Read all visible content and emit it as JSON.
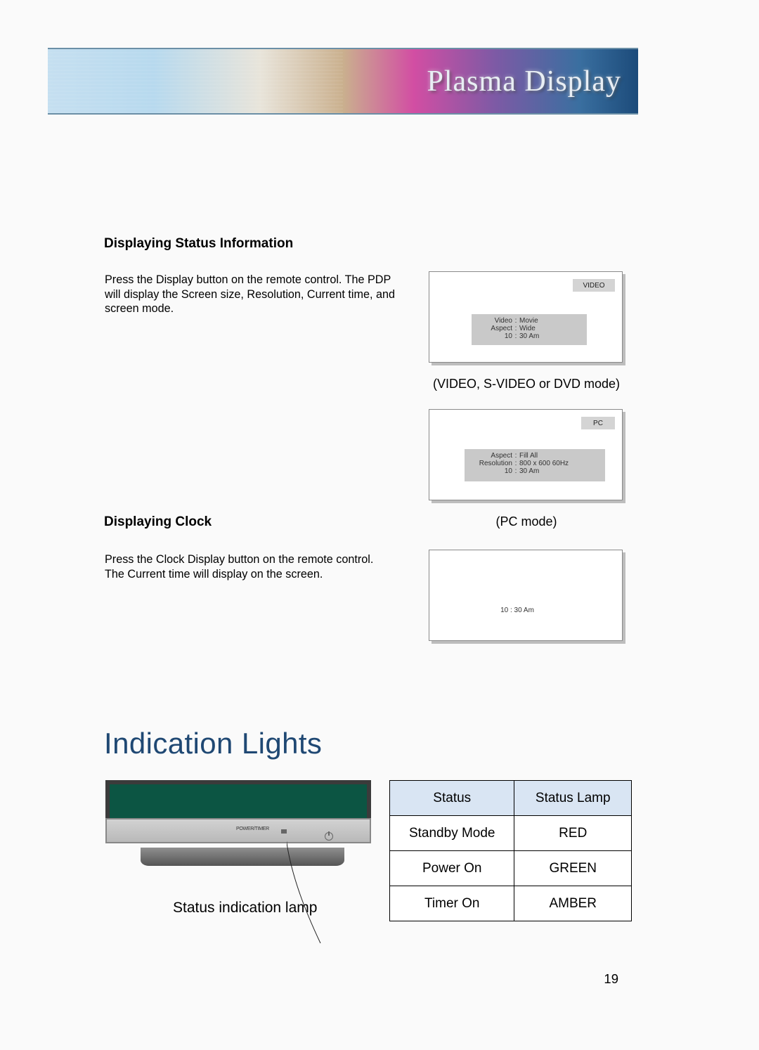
{
  "banner": {
    "title": "Plasma Display"
  },
  "section1": {
    "heading": "Displaying Status Information",
    "body": "Press the Display button on the remote control. The PDP will display the Screen size, Resolution, Current time, and screen mode."
  },
  "screen1": {
    "mode_label": "VIDEO",
    "rows": [
      {
        "label": "Video",
        "value": "Movie"
      },
      {
        "label": "Aspect",
        "value": "Wide"
      },
      {
        "label": "10",
        "value": "30 Am"
      }
    ],
    "caption": "(VIDEO, S-VIDEO or DVD mode)"
  },
  "screen2": {
    "mode_label": "PC",
    "rows": [
      {
        "label": "Aspect",
        "value": "Fill All"
      },
      {
        "label": "Resolution",
        "value": "800 x 600 60Hz"
      },
      {
        "label": "10",
        "value": "30 Am"
      }
    ],
    "caption": "(PC mode)"
  },
  "section2": {
    "heading": "Displaying Clock",
    "body": "Press the Clock Display button on the remote control.\nThe Current time will display on the screen."
  },
  "screen3": {
    "clock": "10 : 30 Am"
  },
  "indication": {
    "title": "Indication Lights",
    "caption": "Status indication lamp",
    "pdp_label": "POWER/TIMER"
  },
  "status_table": {
    "headers": [
      "Status",
      "Status Lamp"
    ],
    "rows": [
      {
        "status": "Standby Mode",
        "lamp": "RED"
      },
      {
        "status": "Power On",
        "lamp": "GREEN"
      },
      {
        "status": "Timer On",
        "lamp": "AMBER"
      }
    ]
  },
  "page_number": "19"
}
